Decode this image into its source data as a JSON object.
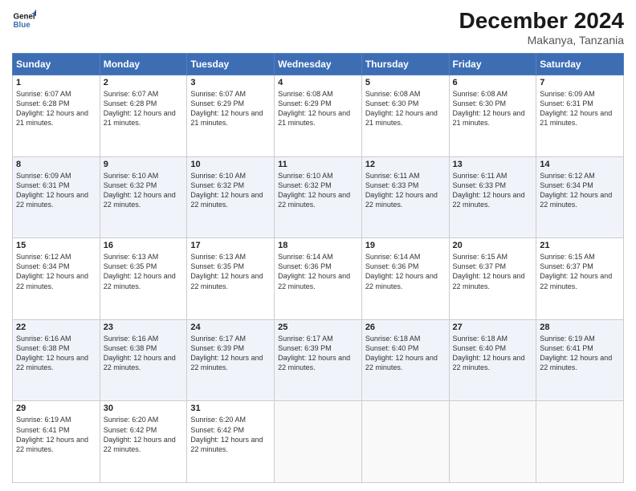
{
  "header": {
    "logo_line1": "General",
    "logo_line2": "Blue",
    "title": "December 2024",
    "subtitle": "Makanya, Tanzania"
  },
  "days_of_week": [
    "Sunday",
    "Monday",
    "Tuesday",
    "Wednesday",
    "Thursday",
    "Friday",
    "Saturday"
  ],
  "weeks": [
    [
      {
        "day": "1",
        "sunrise": "6:07 AM",
        "sunset": "6:28 PM",
        "daylight": "12 hours and 21 minutes."
      },
      {
        "day": "2",
        "sunrise": "6:07 AM",
        "sunset": "6:28 PM",
        "daylight": "12 hours and 21 minutes."
      },
      {
        "day": "3",
        "sunrise": "6:07 AM",
        "sunset": "6:29 PM",
        "daylight": "12 hours and 21 minutes."
      },
      {
        "day": "4",
        "sunrise": "6:08 AM",
        "sunset": "6:29 PM",
        "daylight": "12 hours and 21 minutes."
      },
      {
        "day": "5",
        "sunrise": "6:08 AM",
        "sunset": "6:30 PM",
        "daylight": "12 hours and 21 minutes."
      },
      {
        "day": "6",
        "sunrise": "6:08 AM",
        "sunset": "6:30 PM",
        "daylight": "12 hours and 21 minutes."
      },
      {
        "day": "7",
        "sunrise": "6:09 AM",
        "sunset": "6:31 PM",
        "daylight": "12 hours and 21 minutes."
      }
    ],
    [
      {
        "day": "8",
        "sunrise": "6:09 AM",
        "sunset": "6:31 PM",
        "daylight": "12 hours and 22 minutes."
      },
      {
        "day": "9",
        "sunrise": "6:10 AM",
        "sunset": "6:32 PM",
        "daylight": "12 hours and 22 minutes."
      },
      {
        "day": "10",
        "sunrise": "6:10 AM",
        "sunset": "6:32 PM",
        "daylight": "12 hours and 22 minutes."
      },
      {
        "day": "11",
        "sunrise": "6:10 AM",
        "sunset": "6:32 PM",
        "daylight": "12 hours and 22 minutes."
      },
      {
        "day": "12",
        "sunrise": "6:11 AM",
        "sunset": "6:33 PM",
        "daylight": "12 hours and 22 minutes."
      },
      {
        "day": "13",
        "sunrise": "6:11 AM",
        "sunset": "6:33 PM",
        "daylight": "12 hours and 22 minutes."
      },
      {
        "day": "14",
        "sunrise": "6:12 AM",
        "sunset": "6:34 PM",
        "daylight": "12 hours and 22 minutes."
      }
    ],
    [
      {
        "day": "15",
        "sunrise": "6:12 AM",
        "sunset": "6:34 PM",
        "daylight": "12 hours and 22 minutes."
      },
      {
        "day": "16",
        "sunrise": "6:13 AM",
        "sunset": "6:35 PM",
        "daylight": "12 hours and 22 minutes."
      },
      {
        "day": "17",
        "sunrise": "6:13 AM",
        "sunset": "6:35 PM",
        "daylight": "12 hours and 22 minutes."
      },
      {
        "day": "18",
        "sunrise": "6:14 AM",
        "sunset": "6:36 PM",
        "daylight": "12 hours and 22 minutes."
      },
      {
        "day": "19",
        "sunrise": "6:14 AM",
        "sunset": "6:36 PM",
        "daylight": "12 hours and 22 minutes."
      },
      {
        "day": "20",
        "sunrise": "6:15 AM",
        "sunset": "6:37 PM",
        "daylight": "12 hours and 22 minutes."
      },
      {
        "day": "21",
        "sunrise": "6:15 AM",
        "sunset": "6:37 PM",
        "daylight": "12 hours and 22 minutes."
      }
    ],
    [
      {
        "day": "22",
        "sunrise": "6:16 AM",
        "sunset": "6:38 PM",
        "daylight": "12 hours and 22 minutes."
      },
      {
        "day": "23",
        "sunrise": "6:16 AM",
        "sunset": "6:38 PM",
        "daylight": "12 hours and 22 minutes."
      },
      {
        "day": "24",
        "sunrise": "6:17 AM",
        "sunset": "6:39 PM",
        "daylight": "12 hours and 22 minutes."
      },
      {
        "day": "25",
        "sunrise": "6:17 AM",
        "sunset": "6:39 PM",
        "daylight": "12 hours and 22 minutes."
      },
      {
        "day": "26",
        "sunrise": "6:18 AM",
        "sunset": "6:40 PM",
        "daylight": "12 hours and 22 minutes."
      },
      {
        "day": "27",
        "sunrise": "6:18 AM",
        "sunset": "6:40 PM",
        "daylight": "12 hours and 22 minutes."
      },
      {
        "day": "28",
        "sunrise": "6:19 AM",
        "sunset": "6:41 PM",
        "daylight": "12 hours and 22 minutes."
      }
    ],
    [
      {
        "day": "29",
        "sunrise": "6:19 AM",
        "sunset": "6:41 PM",
        "daylight": "12 hours and 22 minutes."
      },
      {
        "day": "30",
        "sunrise": "6:20 AM",
        "sunset": "6:42 PM",
        "daylight": "12 hours and 22 minutes."
      },
      {
        "day": "31",
        "sunrise": "6:20 AM",
        "sunset": "6:42 PM",
        "daylight": "12 hours and 22 minutes."
      },
      null,
      null,
      null,
      null
    ]
  ]
}
